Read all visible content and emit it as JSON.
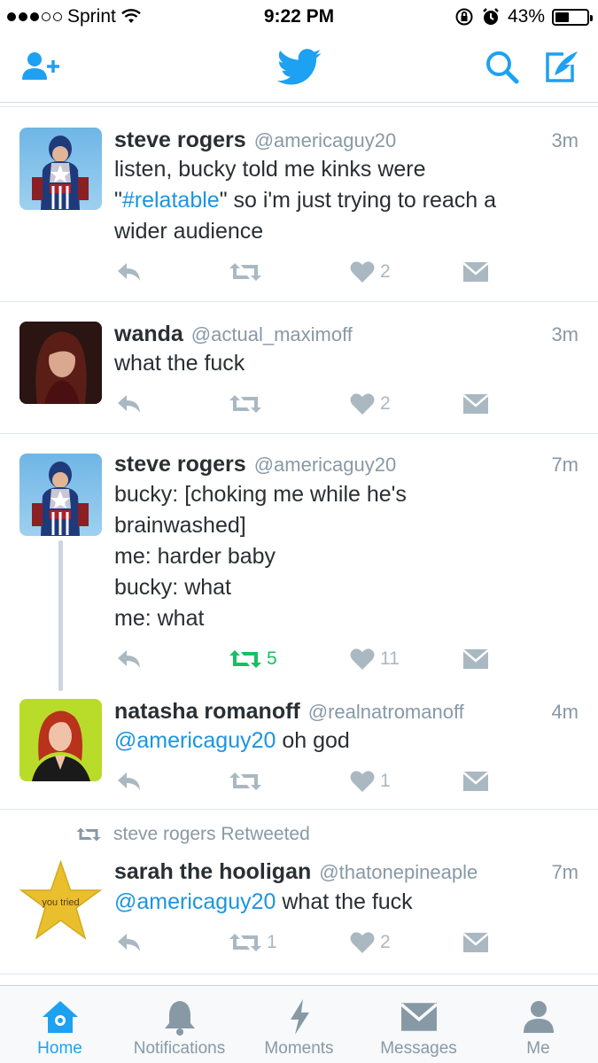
{
  "status_bar": {
    "carrier": "Sprint",
    "time": "9:22 PM",
    "battery": "43%",
    "battery_level": 0.43
  },
  "nav": {
    "add_user_icon": "add-user-icon",
    "logo_icon": "twitter-bird-icon",
    "search_icon": "search-icon",
    "compose_icon": "compose-icon"
  },
  "tweets": [
    {
      "name": "steve rogers",
      "handle": "@americaguy20",
      "time": "3m",
      "lines": [
        {
          "pre": "listen, bucky told me kinks were",
          "link": "",
          "post": ""
        },
        {
          "pre": "\"",
          "link": "#relatable",
          "post": "\" so i'm just trying to reach a"
        },
        {
          "pre": "wider audience",
          "link": "",
          "post": ""
        }
      ],
      "retweets": "",
      "likes": "2"
    },
    {
      "name": "wanda",
      "handle": "@actual_maximoff",
      "time": "3m",
      "lines": [
        {
          "pre": "what the fuck",
          "link": "",
          "post": ""
        }
      ],
      "retweets": "",
      "likes": "2"
    },
    {
      "name": "steve rogers",
      "handle": "@americaguy20",
      "time": "7m",
      "lines": [
        {
          "pre": "bucky: [choking me while he's",
          "link": "",
          "post": ""
        },
        {
          "pre": "brainwashed]",
          "link": "",
          "post": ""
        },
        {
          "pre": "me: harder baby",
          "link": "",
          "post": ""
        },
        {
          "pre": "bucky: what",
          "link": "",
          "post": ""
        },
        {
          "pre": "me: what",
          "link": "",
          "post": ""
        }
      ],
      "retweets": "5",
      "likes": "11"
    },
    {
      "name": "natasha romanoff",
      "handle": "@realnatromanoff",
      "time": "4m",
      "lines": [
        {
          "pre": "",
          "link": "@americaguy20",
          "post": " oh god"
        }
      ],
      "retweets": "",
      "likes": "1"
    },
    {
      "name": "sarah the hooligan",
      "handle": "@thatonepineaple",
      "time": "7m",
      "lines": [
        {
          "pre": "",
          "link": "@americaguy20",
          "post": " what the fuck"
        }
      ],
      "retweets": "1",
      "likes": "2",
      "avatar_text": "you tried"
    }
  ],
  "retweeted_by": "steve rogers Retweeted",
  "tabs": [
    {
      "label": "Home",
      "icon": "home-icon"
    },
    {
      "label": "Notifications",
      "icon": "bell-icon"
    },
    {
      "label": "Moments",
      "icon": "lightning-icon"
    },
    {
      "label": "Messages",
      "icon": "envelope-icon"
    },
    {
      "label": "Me",
      "icon": "person-icon"
    }
  ],
  "colors": {
    "brand": "#1da1f2",
    "link": "#1b95e0",
    "retweet_active": "#17bf63",
    "muted": "#aab8c2"
  }
}
